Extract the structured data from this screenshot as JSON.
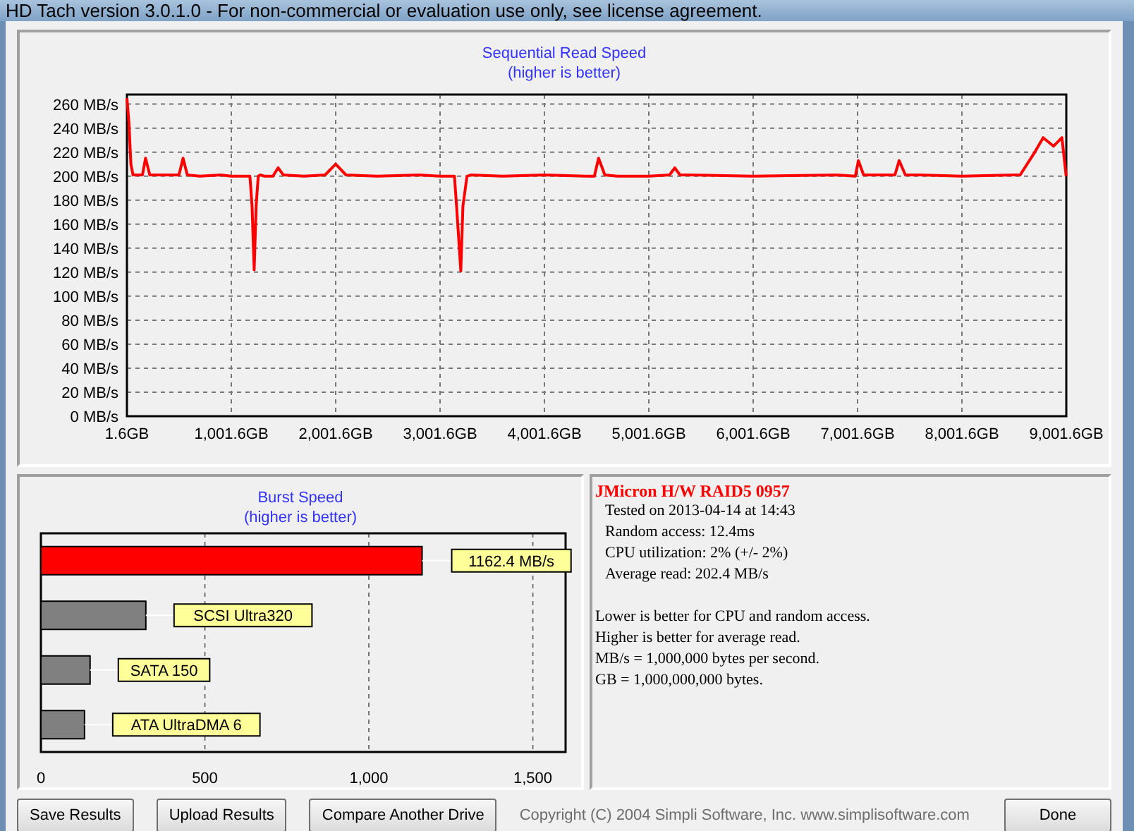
{
  "window": {
    "title": "HD Tach version 3.0.1.0  - For non-commercial or evaluation use only, see license agreement."
  },
  "read_chart": {
    "title": "Sequential Read Speed",
    "subtitle": "(higher is better)",
    "chart_data": {
      "type": "line",
      "x": [
        1.6,
        20,
        40,
        60,
        100,
        150,
        180,
        220,
        300,
        500,
        540,
        580,
        700,
        900,
        1000,
        1180,
        1200,
        1220,
        1240,
        1260,
        1280,
        1320,
        1400,
        1450,
        1500,
        1700,
        1900,
        2001.6,
        2100,
        2400,
        2800,
        3000,
        3140,
        3160,
        3200,
        3220,
        3260,
        3300,
        3600,
        4000,
        4400,
        4480,
        4520,
        4580,
        4700,
        5000,
        5200,
        5250,
        5300,
        5400,
        6000,
        6800,
        6980,
        7010,
        7060,
        7120,
        7360,
        7400,
        7460,
        7600,
        8000,
        8500,
        8560,
        8700,
        8780,
        8880,
        8960,
        9000
      ],
      "grid": true,
      "series": [
        {
          "color": "#ff0000",
          "values": [
            265,
            245,
            210,
            201,
            201,
            201,
            215,
            201,
            201,
            201,
            215,
            201,
            200,
            201,
            200,
            200,
            175,
            122,
            175,
            200,
            201,
            200,
            200,
            207,
            201,
            200,
            201,
            210,
            201,
            200,
            201,
            200,
            200,
            175,
            121,
            175,
            200,
            201,
            200,
            201,
            200,
            200,
            215,
            201,
            200,
            200,
            201,
            207,
            201,
            201,
            200,
            201,
            200,
            213,
            201,
            201,
            201,
            213,
            201,
            201,
            200,
            201,
            201,
            220,
            232,
            225,
            232,
            200
          ]
        }
      ],
      "xlim": [
        1.6,
        9001.6
      ],
      "ylim": [
        0,
        268
      ],
      "xticks": [
        {
          "value": 1.6,
          "label": "1.6GB"
        },
        {
          "value": 1001.6,
          "label": "1,001.6GB"
        },
        {
          "value": 2001.6,
          "label": "2,001.6GB"
        },
        {
          "value": 3001.6,
          "label": "3,001.6GB"
        },
        {
          "value": 4001.6,
          "label": "4,001.6GB"
        },
        {
          "value": 5001.6,
          "label": "5,001.6GB"
        },
        {
          "value": 6001.6,
          "label": "6,001.6GB"
        },
        {
          "value": 7001.6,
          "label": "7,001.6GB"
        },
        {
          "value": 8001.6,
          "label": "8,001.6GB"
        },
        {
          "value": 9001.6,
          "label": "9,001.6GB"
        }
      ],
      "yticks": [
        {
          "value": 0,
          "label": "0 MB/s"
        },
        {
          "value": 20,
          "label": "20 MB/s"
        },
        {
          "value": 40,
          "label": "40 MB/s"
        },
        {
          "value": 60,
          "label": "60 MB/s"
        },
        {
          "value": 80,
          "label": "80 MB/s"
        },
        {
          "value": 100,
          "label": "100 MB/s"
        },
        {
          "value": 120,
          "label": "120 MB/s"
        },
        {
          "value": 140,
          "label": "140 MB/s"
        },
        {
          "value": 160,
          "label": "160 MB/s"
        },
        {
          "value": 180,
          "label": "180 MB/s"
        },
        {
          "value": 200,
          "label": "200 MB/s"
        },
        {
          "value": 220,
          "label": "220 MB/s"
        },
        {
          "value": 240,
          "label": "240 MB/s"
        },
        {
          "value": 260,
          "label": "260 MB/s"
        }
      ]
    }
  },
  "burst_chart": {
    "title": "Burst Speed",
    "subtitle": "(higher is better)",
    "chart_data": {
      "type": "bar",
      "orientation": "horizontal",
      "categories": [
        "1162.4 MB/s",
        "SCSI Ultra320",
        "SATA 150",
        "ATA UltraDMA 6"
      ],
      "series": [
        {
          "color": "#ff0000",
          "values": [
            1162.4,
            null,
            null,
            null
          ]
        },
        {
          "color": "#808080",
          "values": [
            null,
            320,
            150,
            133
          ]
        }
      ],
      "grid": true,
      "xlim": [
        0,
        1600
      ],
      "xticks": [
        {
          "value": 0,
          "label": "0"
        },
        {
          "value": 500,
          "label": "500"
        },
        {
          "value": 1000,
          "label": "1,000"
        },
        {
          "value": 1500,
          "label": "1,500"
        }
      ]
    }
  },
  "info": {
    "heading": "JMicron H/W RAID5 0957",
    "details": [
      "Tested on 2013-04-14 at 14:43",
      "Random access: 12.4ms",
      "CPU utilization: 2% (+/- 2%)",
      "Average read: 202.4 MB/s"
    ],
    "notes": [
      "Lower is better for CPU and random access.",
      "Higher is better for average read.",
      "MB/s = 1,000,000 bytes per second.",
      "GB = 1,000,000,000 bytes."
    ]
  },
  "buttons": [
    "Save Results",
    "Upload Results",
    "Compare Another Drive"
  ],
  "copyright": "Copyright (C) 2004 Simpli Software, Inc. www.simplisoftware.com",
  "done_button": "Done"
}
